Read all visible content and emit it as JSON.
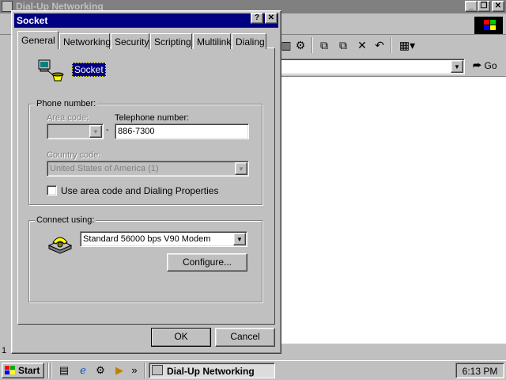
{
  "background_window": {
    "title": "Dial-Up Networking",
    "minimize_label": "_",
    "maximize_label": "❐",
    "close_label": "✕",
    "go_label": "Go",
    "status_text": "1"
  },
  "dialog": {
    "title": "Socket",
    "help_label": "?",
    "close_label": "✕",
    "tabs": [
      {
        "label": "General"
      },
      {
        "label": "Networking"
      },
      {
        "label": "Security"
      },
      {
        "label": "Scripting"
      },
      {
        "label": "Multilink"
      },
      {
        "label": "Dialing"
      }
    ],
    "connection_name": "Socket",
    "phone_group": {
      "label": "Phone number:",
      "area_code_label": "Area code:",
      "area_code_value": "",
      "telephone_label": "Telephone number:",
      "telephone_value": "886-7300",
      "separator": "-",
      "country_label": "Country code:",
      "country_value": "United States of America (1)",
      "use_area_code_label": "Use area code and Dialing Properties",
      "use_area_code_checked": false
    },
    "connect_group": {
      "label": "Connect using:",
      "modem_value": "Standard 56000 bps V90 Modem",
      "configure_label": "Configure..."
    },
    "ok_label": "OK",
    "cancel_label": "Cancel"
  },
  "taskbar": {
    "start_label": "Start",
    "chevron": "»",
    "task_label": "Dial-Up Networking",
    "clock": "6:13 PM"
  },
  "colors": {
    "title_active": "#000080",
    "title_inactive": "#808080",
    "face": "#c0c0c0",
    "desktop_content": "#ffffff"
  }
}
